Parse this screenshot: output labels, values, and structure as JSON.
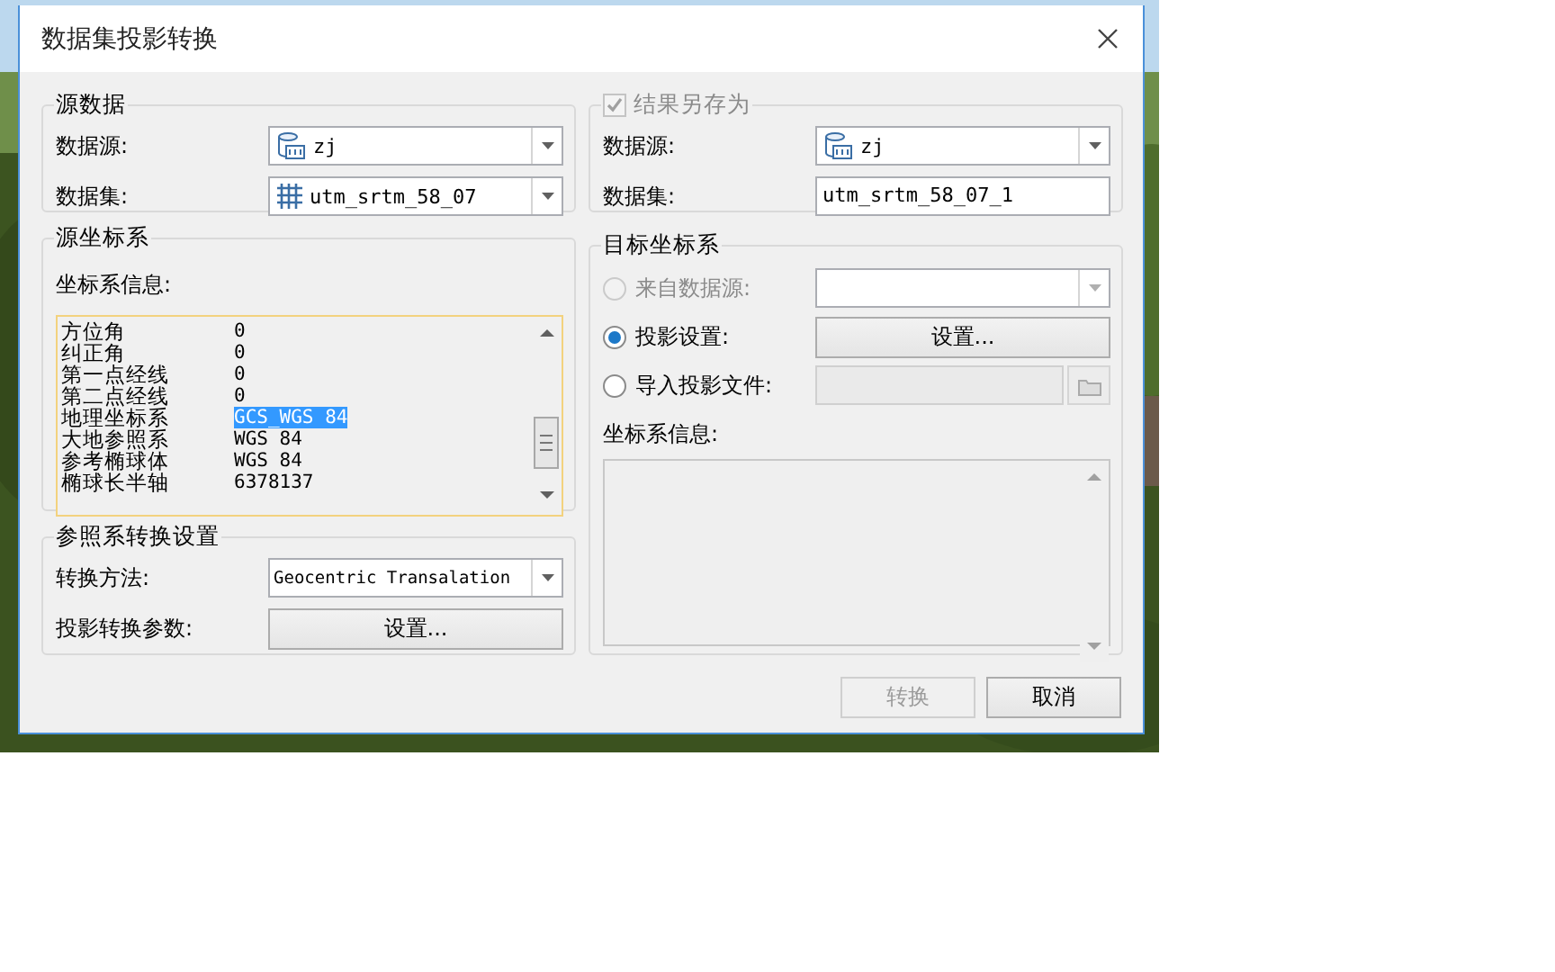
{
  "window": {
    "title": "数据集投影转换"
  },
  "source_data": {
    "title": "源数据",
    "datasource": {
      "label": "数据源:",
      "value": "zj"
    },
    "dataset": {
      "label": "数据集:",
      "value": "utm_srtm_58_07"
    }
  },
  "source_crs": {
    "title": "源坐标系",
    "info_label": "坐标系信息:",
    "info_rows": [
      {
        "name": "方位角",
        "value": "0",
        "selected": false
      },
      {
        "name": "纠正角",
        "value": "0",
        "selected": false
      },
      {
        "name": "第一点经线",
        "value": "0",
        "selected": false
      },
      {
        "name": "第二点经线",
        "value": "0",
        "selected": false
      },
      {
        "name": "地理坐标系",
        "value": "GCS_WGS 84",
        "selected": true
      },
      {
        "name": "大地参照系",
        "value": "WGS 84",
        "selected": false
      },
      {
        "name": "参考椭球体",
        "value": "WGS 84",
        "selected": false
      },
      {
        "name": "椭球长半轴",
        "value": "6378137",
        "selected": false
      }
    ]
  },
  "transform_settings": {
    "title": "参照系转换设置",
    "method": {
      "label": "转换方法:",
      "value": "Geocentric Transalation"
    },
    "params": {
      "label": "投影转换参数:",
      "button": "设置..."
    }
  },
  "save_as": {
    "title": "结果另存为",
    "checked": true,
    "disabled": true,
    "datasource": {
      "label": "数据源:",
      "value": "zj"
    },
    "dataset": {
      "label": "数据集:",
      "value": "utm_srtm_58_07_1"
    }
  },
  "target_crs": {
    "title": "目标坐标系",
    "options": [
      {
        "kind": "combo",
        "label": "来自数据源:",
        "selected": false,
        "disabled": true
      },
      {
        "kind": "button",
        "label": "投影设置:",
        "selected": true,
        "disabled": false,
        "button": "设置..."
      },
      {
        "kind": "file",
        "label": "导入投影文件:",
        "selected": false,
        "disabled": false
      }
    ],
    "info_label": "坐标系信息:"
  },
  "buttons": [
    {
      "label": "转换",
      "disabled": true
    },
    {
      "label": "取消",
      "disabled": false
    }
  ]
}
